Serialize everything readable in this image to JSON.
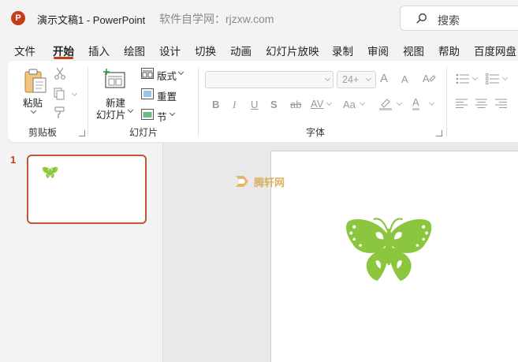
{
  "titlebar": {
    "app_icon_letter": "P",
    "document_title": "演示文稿1  -  PowerPoint",
    "site_note": "软件自学网：rjzxw.com",
    "search_placeholder": "搜索"
  },
  "tabs": [
    {
      "label": "文件"
    },
    {
      "label": "开始",
      "active": true
    },
    {
      "label": "插入"
    },
    {
      "label": "绘图"
    },
    {
      "label": "设计"
    },
    {
      "label": "切换"
    },
    {
      "label": "动画"
    },
    {
      "label": "幻灯片放映"
    },
    {
      "label": "录制"
    },
    {
      "label": "审阅"
    },
    {
      "label": "视图"
    },
    {
      "label": "帮助"
    },
    {
      "label": "百度网盘"
    }
  ],
  "ribbon": {
    "clipboard": {
      "paste_label": "粘贴",
      "group_label": "剪贴板"
    },
    "slides": {
      "new_slide_label_line1": "新建",
      "new_slide_label_line2": "幻灯片",
      "layout_label": "版式",
      "reset_label": "重置",
      "section_label": "节",
      "group_label": "幻灯片"
    },
    "font": {
      "font_name_value": "",
      "font_size_value": "24+",
      "grow_glyph": "A",
      "shrink_glyph": "A",
      "bold_glyph": "B",
      "italic_glyph": "I",
      "underline_glyph": "U",
      "shadow_glyph": "S",
      "strike_glyph": "ab",
      "spacing_glyph": "AV",
      "case_glyph": "Aa",
      "font_color_glyph": "A",
      "group_label": "字体"
    }
  },
  "thumbnails": [
    {
      "number": "1",
      "selected": true
    }
  ],
  "watermark": {
    "text": "腾轩网"
  },
  "colors": {
    "accent": "#c43e1c",
    "butterfly": "#8cc63f",
    "selection_border": "#c4533a"
  }
}
